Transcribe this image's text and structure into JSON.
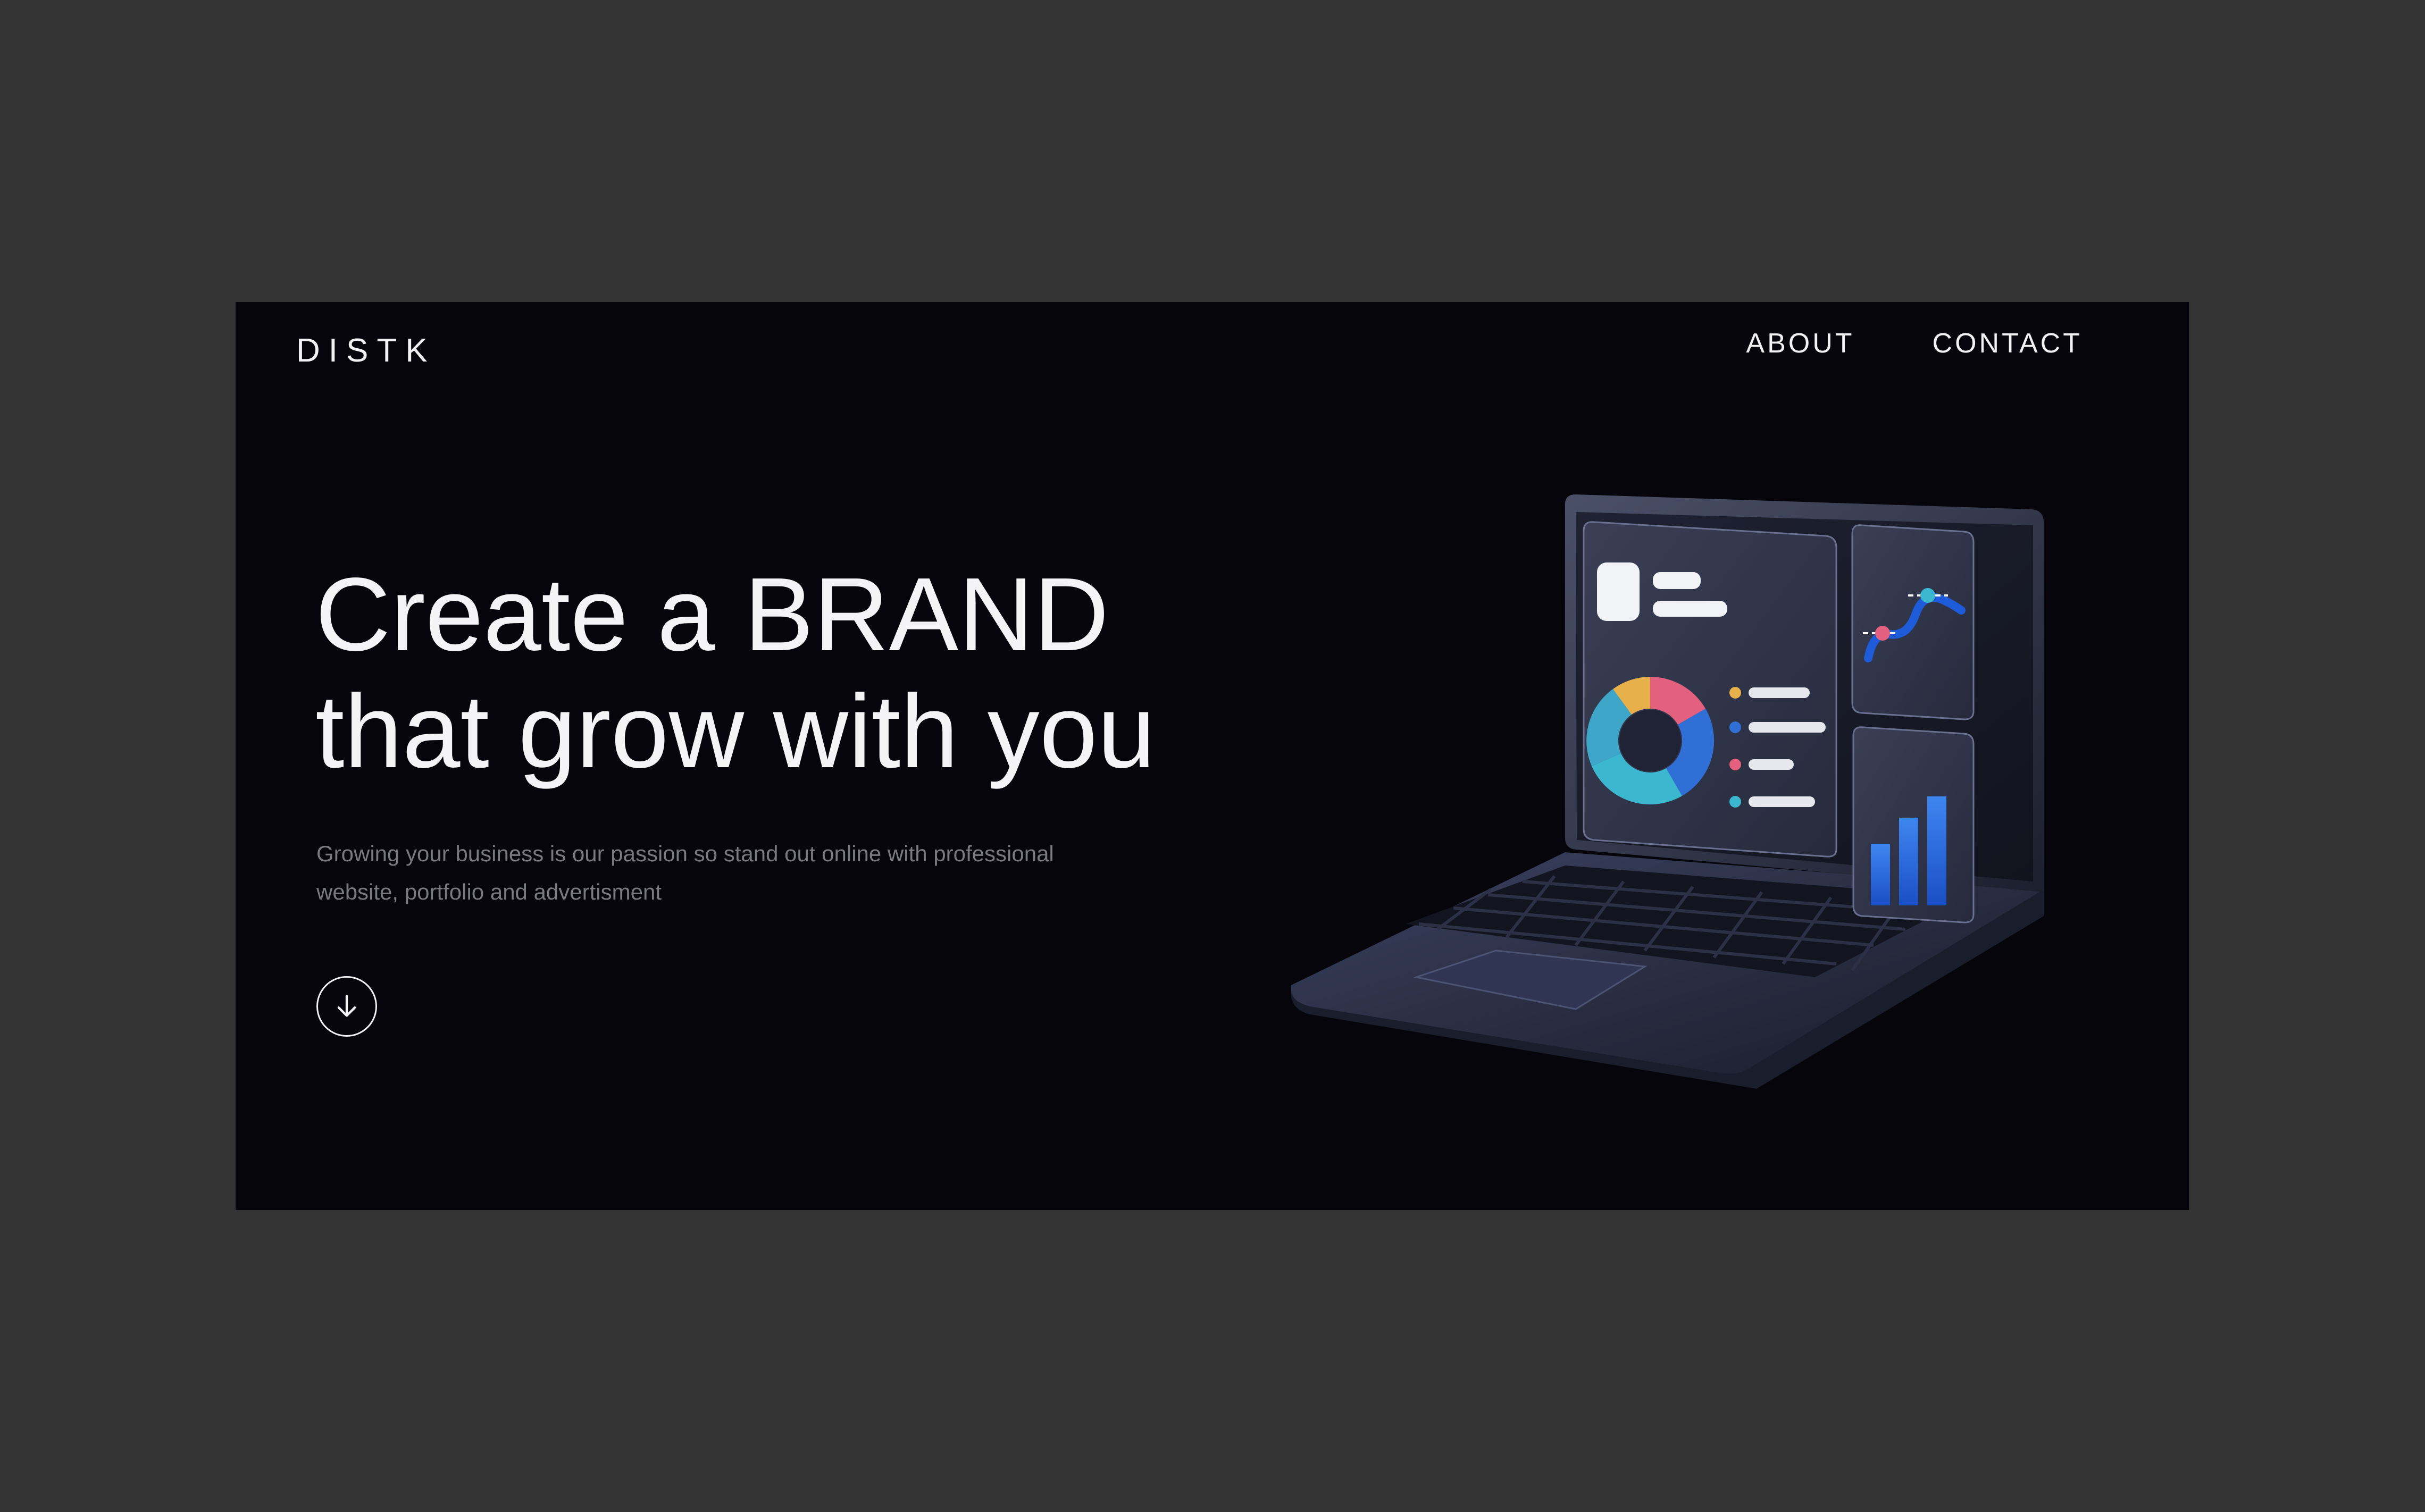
{
  "brand": {
    "logo": "DISTK"
  },
  "nav": {
    "items": [
      {
        "label": "ABOUT"
      },
      {
        "label": "CONTACT"
      }
    ]
  },
  "hero": {
    "title_line1": "Create a BRAND",
    "title_line2": "that grow with you",
    "subtitle_line1": "Growing your business is our passion so stand out online with professional",
    "subtitle_line2": "website, portfolio and advertisment",
    "scroll_icon": "arrow-down-icon"
  },
  "illustration": {
    "description_icon": "laptop-dashboard-illustration",
    "donut_colors": [
      "#e8b04a",
      "#e4607f",
      "#2f6fd6",
      "#3bb7d0"
    ]
  },
  "colors": {
    "page_background": "#333333",
    "hero_background": "#06050b",
    "text_primary": "#f4f4f6",
    "text_muted": "#7a7a82",
    "accent_blue": "#1e5bd8"
  }
}
